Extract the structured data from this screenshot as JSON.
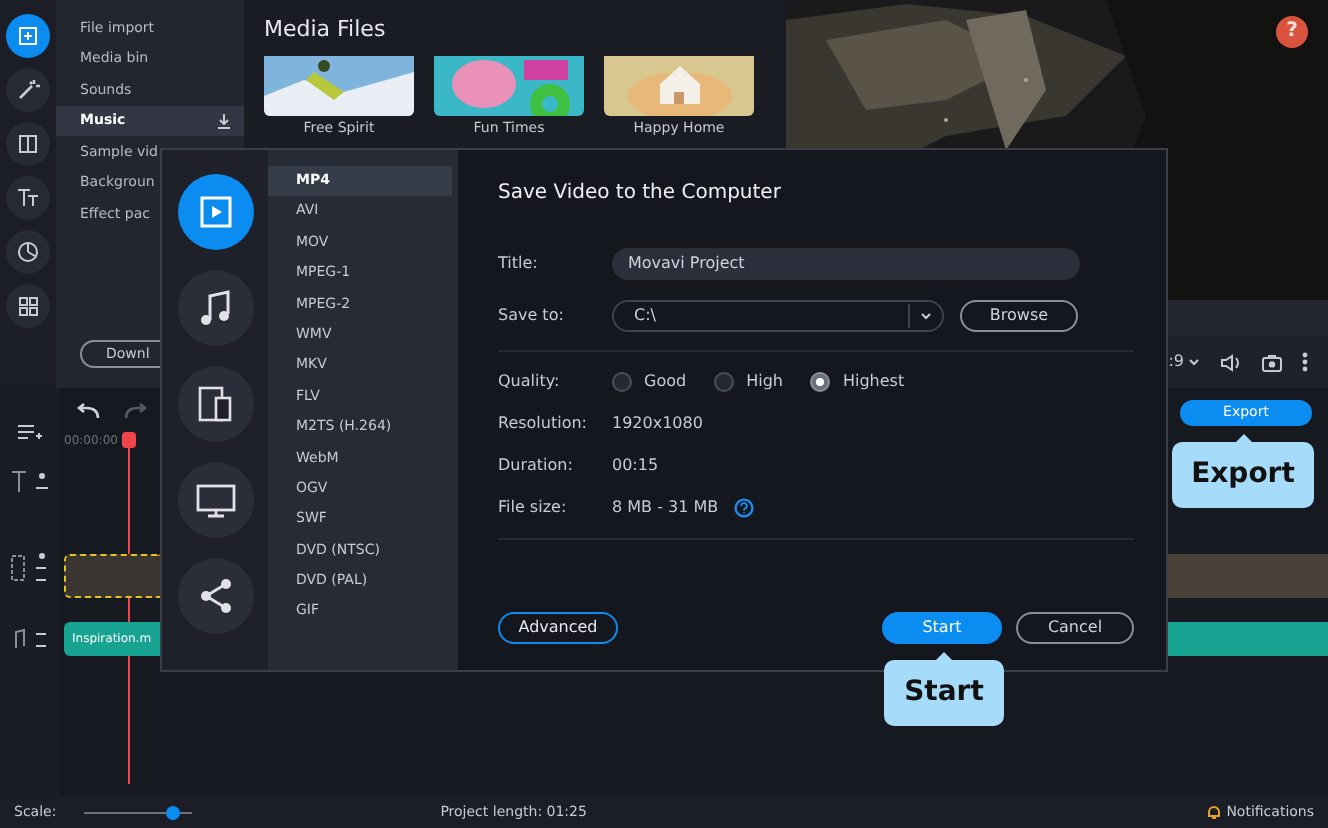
{
  "rail": [
    {
      "selected": true
    },
    {
      "selected": false
    },
    {
      "selected": false
    },
    {
      "selected": false
    },
    {
      "selected": false
    },
    {
      "selected": false
    }
  ],
  "sidebar": {
    "items": [
      {
        "label": "File import",
        "selected": false
      },
      {
        "label": "Media bin",
        "selected": false
      },
      {
        "label": "Sounds",
        "selected": false
      },
      {
        "label": "Music",
        "selected": true
      },
      {
        "label": "Sample vid",
        "selected": false
      },
      {
        "label": "Backgroun",
        "selected": false
      },
      {
        "label": "Effect pac",
        "selected": false
      }
    ],
    "download_button": "Downl"
  },
  "media": {
    "title": "Media Files",
    "items": [
      {
        "label": "Free Spirit"
      },
      {
        "label": "Fun Times"
      },
      {
        "label": "Happy Home"
      }
    ]
  },
  "help_button": "?",
  "player": {
    "aspect": ":9"
  },
  "export_button": "Export",
  "timeline": {
    "timecode": "00:00:00",
    "audio_clip": "Inspiration.m"
  },
  "status_bar": {
    "scale_label": "Scale:",
    "scale": {
      "level": 0.82
    },
    "project_length": "Project length: 01:25",
    "notifications": "Notifications"
  },
  "dialog": {
    "categories": [
      {
        "selected": true
      },
      {
        "selected": false
      },
      {
        "selected": false
      },
      {
        "selected": false
      },
      {
        "selected": false
      }
    ],
    "formats": [
      {
        "label": "MP4",
        "selected": true
      },
      {
        "label": "AVI",
        "selected": false
      },
      {
        "label": "MOV",
        "selected": false
      },
      {
        "label": "MPEG-1",
        "selected": false
      },
      {
        "label": "MPEG-2",
        "selected": false
      },
      {
        "label": "WMV",
        "selected": false
      },
      {
        "label": "MKV",
        "selected": false
      },
      {
        "label": "FLV",
        "selected": false
      },
      {
        "label": "M2TS (H.264)",
        "selected": false
      },
      {
        "label": "WebM",
        "selected": false
      },
      {
        "label": "OGV",
        "selected": false
      },
      {
        "label": "SWF",
        "selected": false
      },
      {
        "label": "DVD (NTSC)",
        "selected": false
      },
      {
        "label": "DVD (PAL)",
        "selected": false
      },
      {
        "label": "GIF",
        "selected": false
      }
    ],
    "title": "Save Video to the Computer",
    "title_field": {
      "label": "Title:",
      "value": "Movavi Project"
    },
    "save_to": {
      "label": "Save to:",
      "value": "C:\\",
      "browse": "Browse"
    },
    "quality": {
      "label": "Quality:",
      "options": [
        {
          "label": "Good",
          "selected": false
        },
        {
          "label": "High",
          "selected": false
        },
        {
          "label": "Highest",
          "selected": true
        }
      ]
    },
    "info": [
      {
        "label": "Resolution:",
        "value": "1920x1080"
      },
      {
        "label": "Duration:",
        "value": "00:15"
      },
      {
        "label": "File size:",
        "value": "8 MB - 31 MB"
      }
    ],
    "advanced_button": "Advanced",
    "start_button": "Start",
    "cancel_button": "Cancel"
  },
  "callouts": [
    {
      "label": "Export"
    },
    {
      "label": "Start"
    }
  ]
}
